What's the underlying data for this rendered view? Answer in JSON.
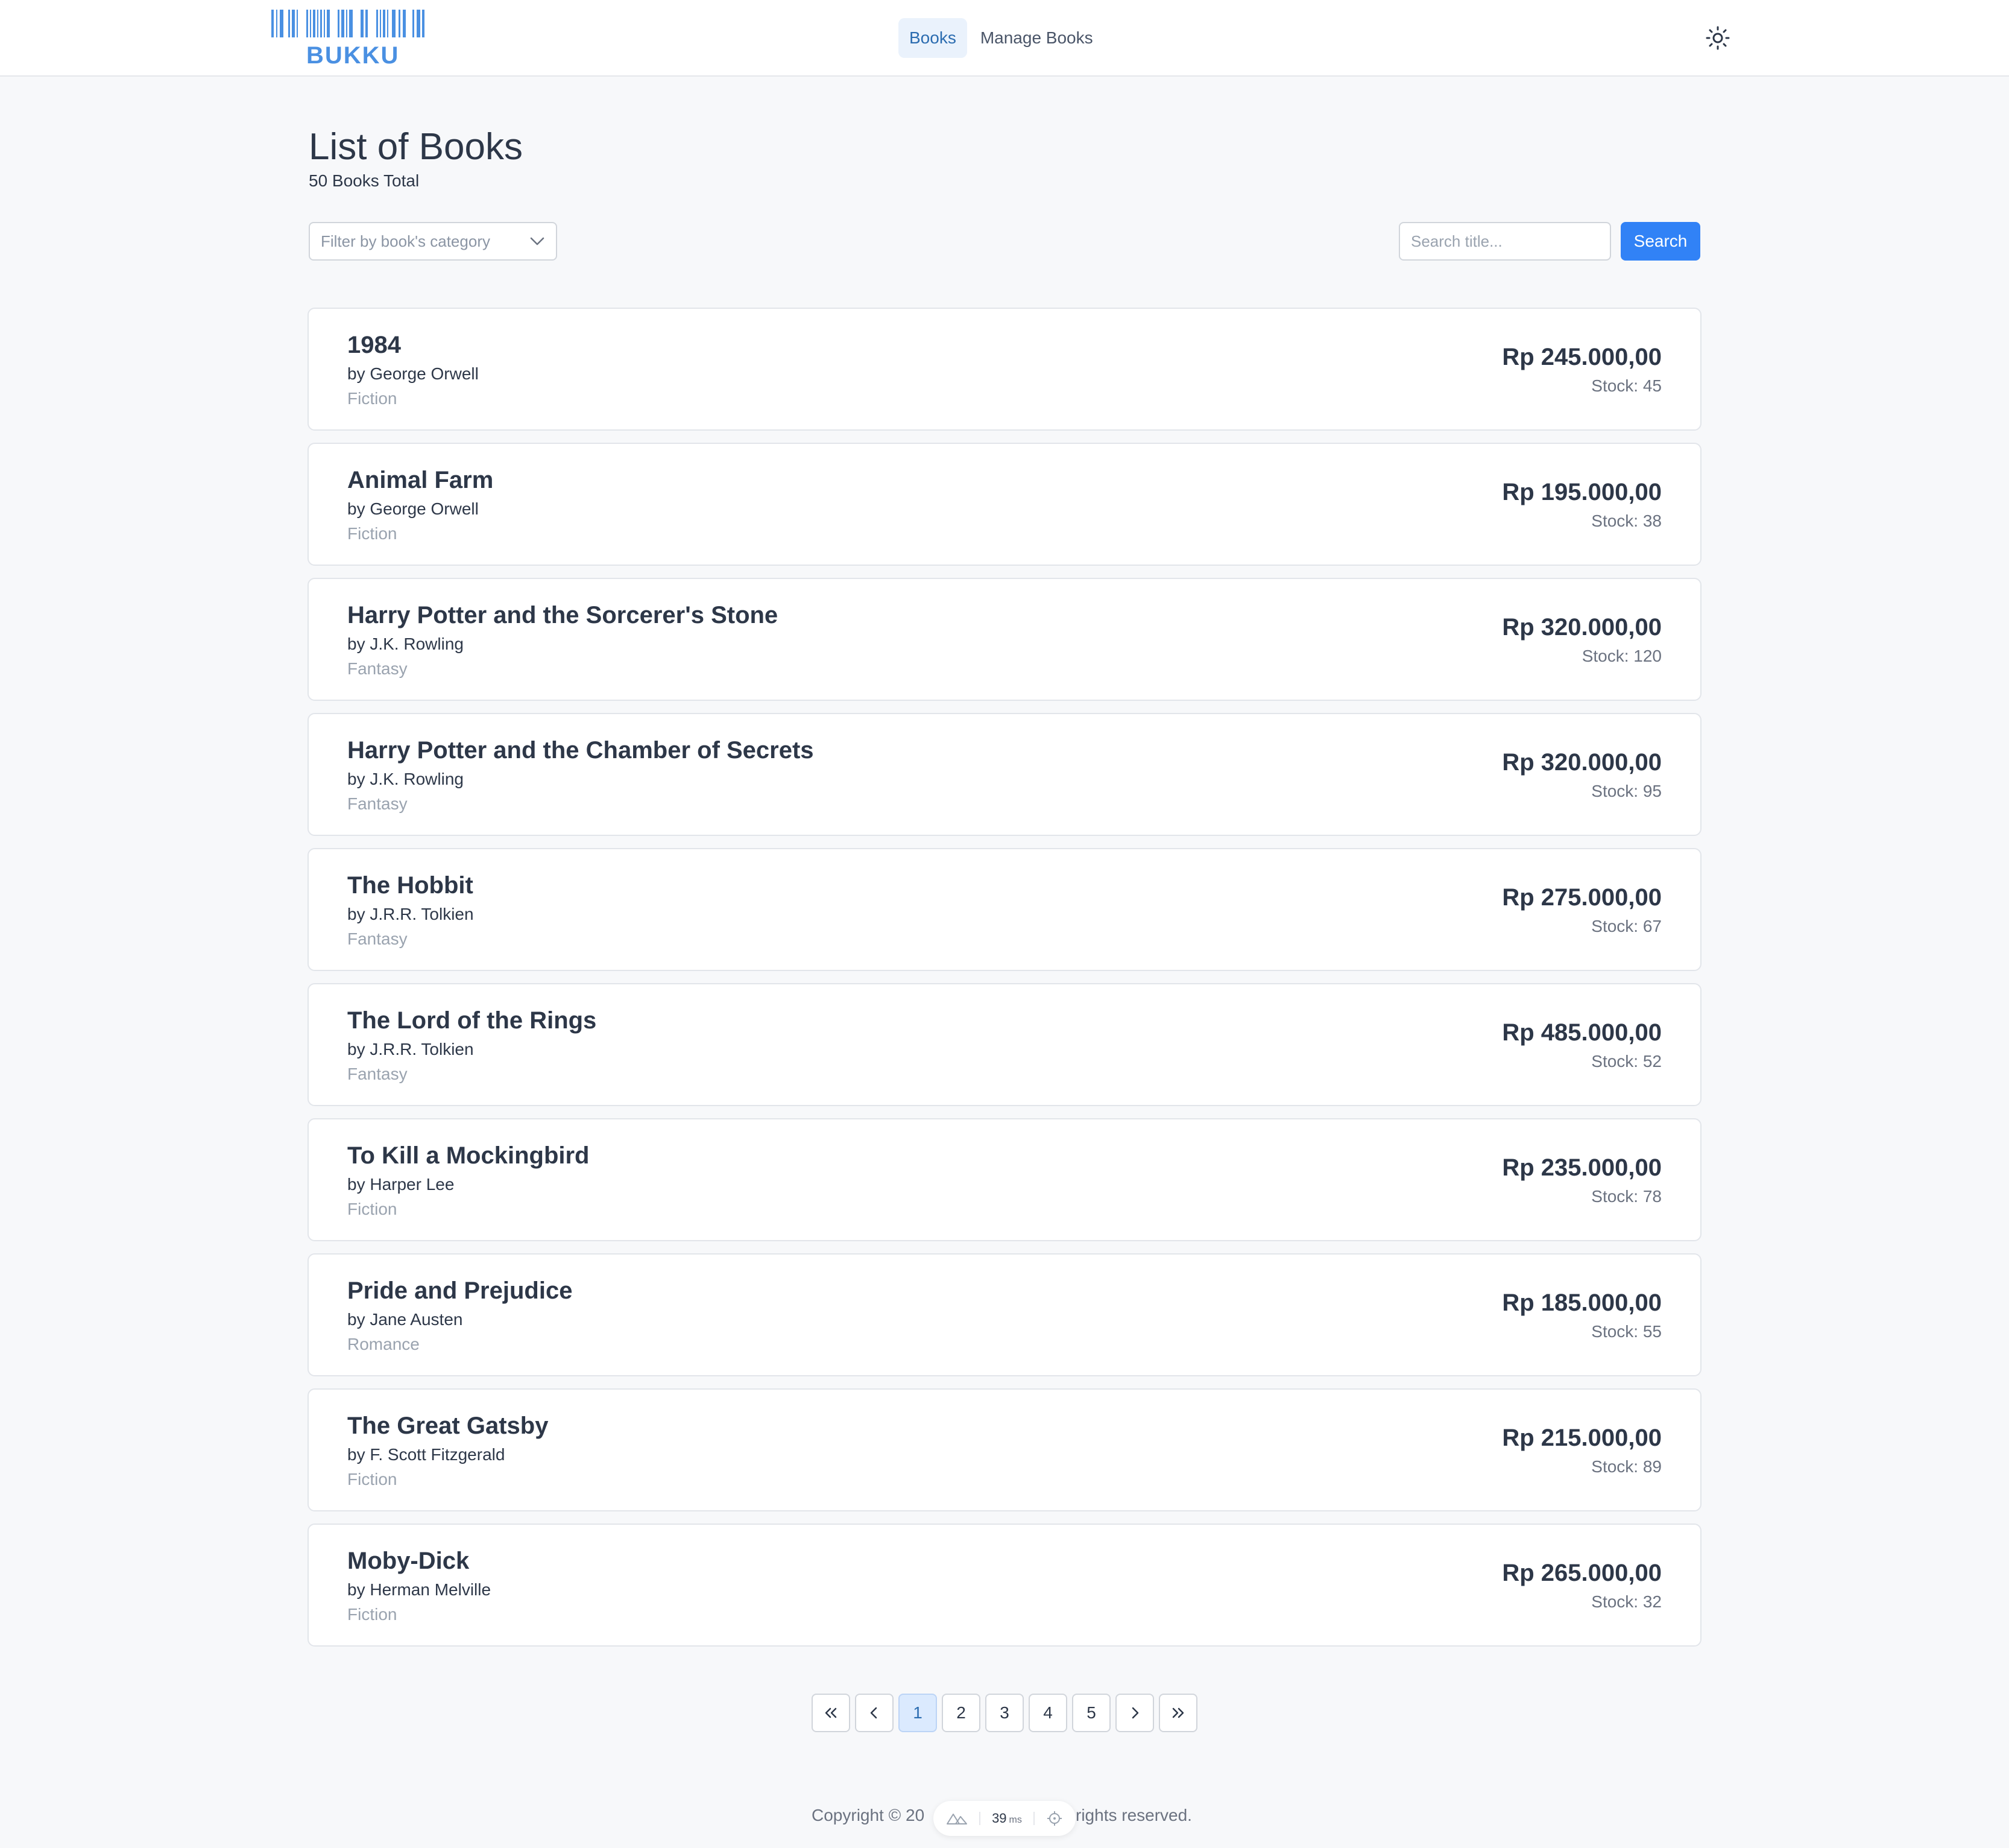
{
  "header": {
    "logo_text": "BUKKU",
    "nav": [
      {
        "label": "Books",
        "active": true
      },
      {
        "label": "Manage Books",
        "active": false
      }
    ],
    "theme_icon": "sun-icon"
  },
  "page": {
    "title": "List of Books",
    "subtitle": "50 Books Total"
  },
  "filter": {
    "placeholder": "Filter by book's category",
    "icon": "chevron-down-icon"
  },
  "search": {
    "placeholder": "Search title...",
    "button_label": "Search"
  },
  "books": [
    {
      "title": "1984",
      "author": "by George Orwell",
      "category": "Fiction",
      "price": "Rp 245.000,00",
      "stock": "Stock: 45"
    },
    {
      "title": "Animal Farm",
      "author": "by George Orwell",
      "category": "Fiction",
      "price": "Rp 195.000,00",
      "stock": "Stock: 38"
    },
    {
      "title": "Harry Potter and the Sorcerer's Stone",
      "author": "by J.K. Rowling",
      "category": "Fantasy",
      "price": "Rp 320.000,00",
      "stock": "Stock: 120"
    },
    {
      "title": "Harry Potter and the Chamber of Secrets",
      "author": "by J.K. Rowling",
      "category": "Fantasy",
      "price": "Rp 320.000,00",
      "stock": "Stock: 95"
    },
    {
      "title": "The Hobbit",
      "author": "by J.R.R. Tolkien",
      "category": "Fantasy",
      "price": "Rp 275.000,00",
      "stock": "Stock: 67"
    },
    {
      "title": "The Lord of the Rings",
      "author": "by J.R.R. Tolkien",
      "category": "Fantasy",
      "price": "Rp 485.000,00",
      "stock": "Stock: 52"
    },
    {
      "title": "To Kill a Mockingbird",
      "author": "by Harper Lee",
      "category": "Fiction",
      "price": "Rp 235.000,00",
      "stock": "Stock: 78"
    },
    {
      "title": "Pride and Prejudice",
      "author": "by Jane Austen",
      "category": "Romance",
      "price": "Rp 185.000,00",
      "stock": "Stock: 55"
    },
    {
      "title": "The Great Gatsby",
      "author": "by F. Scott Fitzgerald",
      "category": "Fiction",
      "price": "Rp 215.000,00",
      "stock": "Stock: 89"
    },
    {
      "title": "Moby-Dick",
      "author": "by Herman Melville",
      "category": "Fiction",
      "price": "Rp 265.000,00",
      "stock": "Stock: 32"
    }
  ],
  "pagination": {
    "pages": [
      "1",
      "2",
      "3",
      "4",
      "5"
    ],
    "current": "1",
    "first_icon": "double-chevron-left-icon",
    "prev_icon": "chevron-left-icon",
    "next_icon": "chevron-right-icon",
    "last_icon": "double-chevron-right-icon"
  },
  "footer": {
    "left_text": "Copyright © 20",
    "right_text": "rights reserved."
  },
  "devbar": {
    "value": "39",
    "unit": "ms"
  },
  "colors": {
    "accent": "#3182f6",
    "logo": "#4a90e2",
    "background": "#f7f8fa"
  }
}
